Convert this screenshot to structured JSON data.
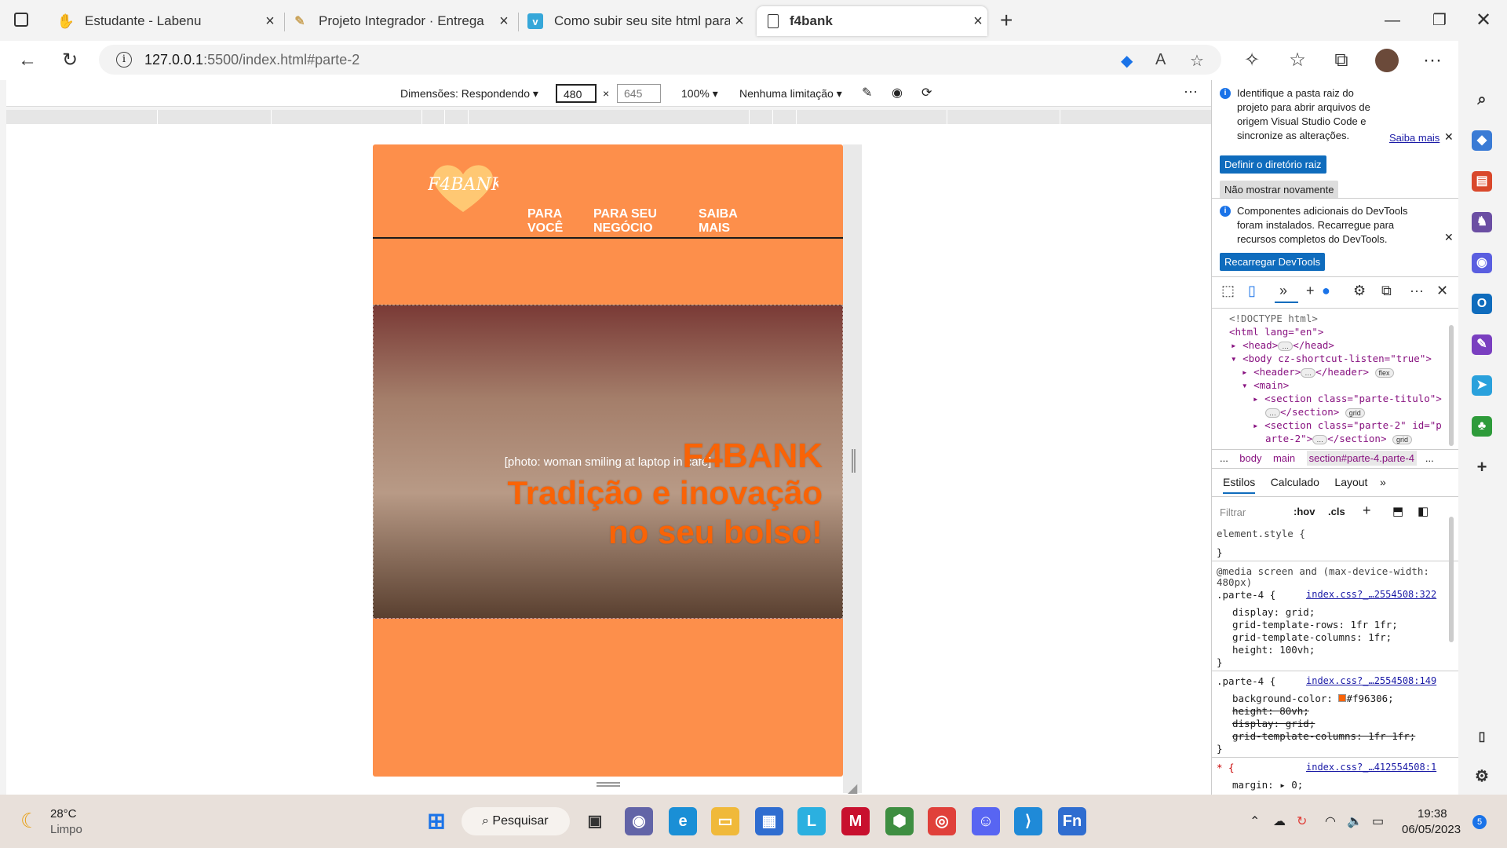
{
  "browser": {
    "tabs": [
      {
        "title": "Estudante - Labenu",
        "icon": "labenu-favicon"
      },
      {
        "title": "Projeto Integrador · Entrega",
        "icon": "notion-favicon"
      },
      {
        "title": "Como subir seu site html para a",
        "icon": "vimeo-favicon"
      },
      {
        "title": "f4bank",
        "icon": "page-icon",
        "active": true
      }
    ],
    "url_host": "127.0.0.1",
    "url_rest": ":5500/index.html#parte-2"
  },
  "device_toolbar": {
    "dimensions_label": "Dimensões: Respondendo",
    "width": "480",
    "times": "×",
    "height": "645",
    "zoom": "100%",
    "throttle": "Nenhuma limitação",
    "more": "···"
  },
  "site": {
    "logo_text": "F4BANK",
    "nav": [
      {
        "line1": "PARA",
        "line2": "VOCÊ"
      },
      {
        "line1": "PARA SEU",
        "line2": "NEGÓCIO"
      },
      {
        "line1": "SAIBA",
        "line2": "MAIS"
      }
    ],
    "hero_title": "F4BANK",
    "hero_line1": "Tradição e inovação",
    "hero_line2": "no seu bolso!",
    "hero_image_label": "[photo: woman smiling at laptop in café]",
    "accent": "#f96306",
    "background": "#fd8f4b"
  },
  "devtools": {
    "info1": {
      "text": "Identifique a pasta raiz do projeto para abrir arquivos de origem Visual Studio Code e sincronize as alterações.",
      "link": "Saiba mais",
      "primary": "Definir o diretório raiz",
      "secondary": "Não mostrar novamente"
    },
    "info2": {
      "text": "Componentes adicionais do DevTools foram instalados. Recarregue para recursos completos do DevTools.",
      "primary": "Recarregar DevTools"
    },
    "dom": [
      "<!DOCTYPE html>",
      "<html lang=\"en\">",
      "<head>",
      "</head>",
      "<body cz-shortcut-listen=\"true\">",
      "<header>",
      "</header>",
      "flex",
      "<main>",
      "<section class=\"parte-titulo\">",
      "</section>",
      "grid",
      "<section class=\"parte-2\" id=\"p",
      "arte-2\">",
      "</section>",
      "grid"
    ],
    "breadcrumb": [
      "...",
      "body",
      "main",
      "section#parte-4.parte-4",
      "..."
    ],
    "tabs": [
      "Estilos",
      "Calculado",
      "Layout"
    ],
    "filter_placeholder": "Filtrar",
    "hov": ":hov",
    "cls": ".cls",
    "styles": {
      "element_style": "element.style {",
      "close": "}",
      "media": "@media screen and (max-device-width:",
      "media2": "480px)",
      "rule1_selector": ".parte-4 {",
      "rule1_link": "index.css?_…2554508:322",
      "rule1_props": [
        "display: grid;",
        "grid-template-rows: 1fr 1fr;",
        "grid-template-columns: 1fr;",
        "height: 100vh;"
      ],
      "rule2_selector": ".parte-4 {",
      "rule2_link": "index.css?_…2554508:149",
      "rule2_props": [
        "background-color:",
        "#f96306;",
        "height: 80vh;",
        "display: grid;",
        "grid-template-columns: 1fr 1fr;"
      ],
      "rule3_selector": "* {",
      "rule3_link": "index.css?_…412554508:1",
      "rule3_props": [
        "margin: ",
        "0;"
      ]
    }
  },
  "taskbar": {
    "weather_temp": "28°C",
    "weather_desc": "Limpo",
    "search": "Pesquisar",
    "time": "19:38",
    "date": "06/05/2023",
    "notif": "5"
  }
}
